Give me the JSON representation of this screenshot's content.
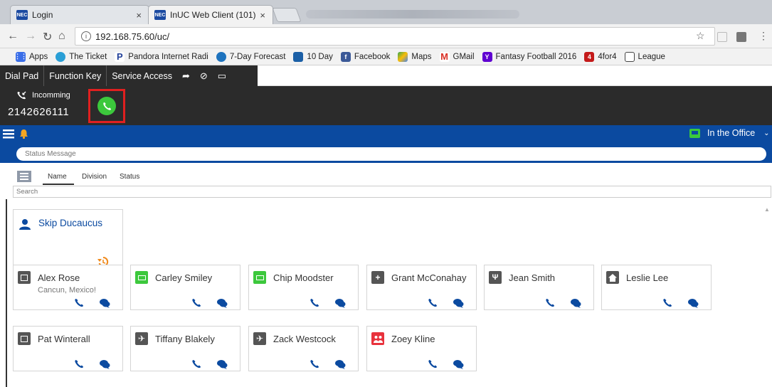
{
  "browser": {
    "tabs": [
      {
        "label": "Login",
        "favicon": "NEC"
      },
      {
        "label": "InUC Web Client (101)",
        "favicon": "NEC"
      }
    ],
    "url": "192.168.75.60/uc/",
    "bookmarks": [
      {
        "label": "Apps",
        "icon": "apps-grid-icon",
        "color": "#3a6ee8"
      },
      {
        "label": "The Ticket",
        "icon": "ticket-icon",
        "color": "#2a9fd6"
      },
      {
        "label": "Pandora Internet Radi",
        "icon": "pandora-icon",
        "color": "#224099"
      },
      {
        "label": "7-Day Forecast",
        "icon": "weather-icon",
        "color": "#1e73be"
      },
      {
        "label": "10 Day",
        "icon": "calendar-icon",
        "color": "#1b5fa6"
      },
      {
        "label": "Facebook",
        "icon": "facebook-icon",
        "color": "#3b5998"
      },
      {
        "label": "Maps",
        "icon": "maps-icon",
        "color": "#34a853"
      },
      {
        "label": "GMail",
        "icon": "gmail-icon",
        "color": "#d93025"
      },
      {
        "label": "Fantasy Football 2016",
        "icon": "yahoo-icon",
        "color": "#5f01d1"
      },
      {
        "label": "4for4",
        "icon": "4for4-icon",
        "color": "#c41a1a"
      },
      {
        "label": "League",
        "icon": "league-icon",
        "color": "#444444"
      }
    ]
  },
  "app": {
    "toolbar": [
      "Dial Pad",
      "Function Key",
      "Service Access"
    ],
    "call": {
      "label": "Incomming",
      "number": "2142626111"
    },
    "presence": "In the Office",
    "status_placeholder": "Status Message",
    "sort_tabs": [
      "Name",
      "Division",
      "Status"
    ],
    "search_placeholder": "Search",
    "featured": {
      "name": "Skip Ducaucus"
    },
    "contacts": [
      {
        "name": "Alex Rose",
        "note": "Cancun, Mexico!",
        "status": "vacation",
        "status_color": "#555555"
      },
      {
        "name": "Carley Smiley",
        "note": "",
        "status": "in-office",
        "status_color": "#3cc83c"
      },
      {
        "name": "Chip Moodster",
        "note": "",
        "status": "in-office",
        "status_color": "#3cc83c"
      },
      {
        "name": "Grant McConahay",
        "note": "",
        "status": "medical",
        "status_color": "#555555"
      },
      {
        "name": "Jean Smith",
        "note": "",
        "status": "lunch",
        "status_color": "#555555"
      },
      {
        "name": "Leslie Lee",
        "note": "",
        "status": "home",
        "status_color": "#555555"
      },
      {
        "name": "Pat Winterall",
        "note": "",
        "status": "vacation",
        "status_color": "#555555"
      },
      {
        "name": "Tiffany Blakely",
        "note": "",
        "status": "travel",
        "status_color": "#555555"
      },
      {
        "name": "Zack Westcock",
        "note": "",
        "status": "travel",
        "status_color": "#555555"
      },
      {
        "name": "Zoey Kline",
        "note": "",
        "status": "meeting",
        "status_color": "#e8323c"
      }
    ],
    "accent": "#0b4aa0",
    "action_color": "#0b4aa0"
  }
}
